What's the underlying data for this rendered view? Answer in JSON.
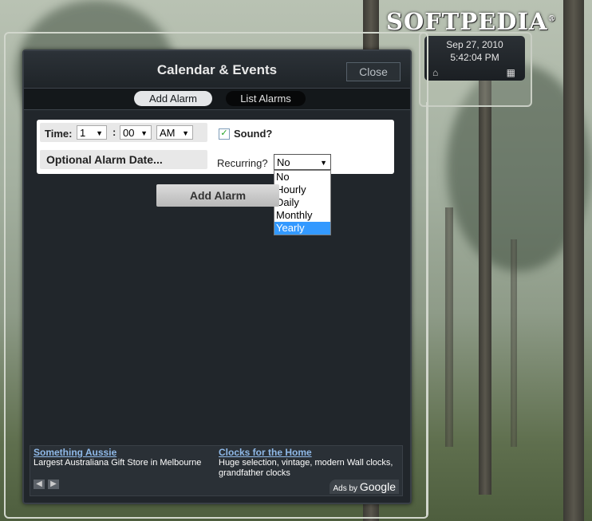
{
  "watermark": {
    "text": "SOFTPEDIA",
    "mark": "®"
  },
  "clock": {
    "date": "Sep 27, 2010",
    "time": "5:42:04 PM",
    "left_icon": "home-icon",
    "right_icon": "calendar-icon"
  },
  "window": {
    "title": "Calendar & Events",
    "close_label": "Close"
  },
  "tabs": [
    {
      "label": "Add Alarm"
    },
    {
      "label": "List Alarms"
    }
  ],
  "form": {
    "time_label": "Time:",
    "hour": "1",
    "separator": ":",
    "minute": "00",
    "ampm": "AM",
    "sound_label": "Sound?",
    "sound_checked": "✓",
    "date_button": "Optional Alarm Date...",
    "recurring_label": "Recurring?",
    "recurring_value": "No",
    "recurring_options": [
      "No",
      "Hourly",
      "Daily",
      "Monthly",
      "Yearly"
    ],
    "recurring_highlighted": "Yearly"
  },
  "add_button": "Add Alarm",
  "ads": [
    {
      "title": "Something Aussie",
      "text": "Largest Australiana Gift Store in Melbourne"
    },
    {
      "title": "Clocks for the Home",
      "text": "Huge selection, vintage, modern Wall clocks, grandfather clocks"
    }
  ],
  "ads_by": {
    "prefix": "Ads by",
    "brand": "Google"
  },
  "colors": {
    "panel": "#21262b",
    "link": "#8fb9e8",
    "highlight": "#3399ff"
  }
}
